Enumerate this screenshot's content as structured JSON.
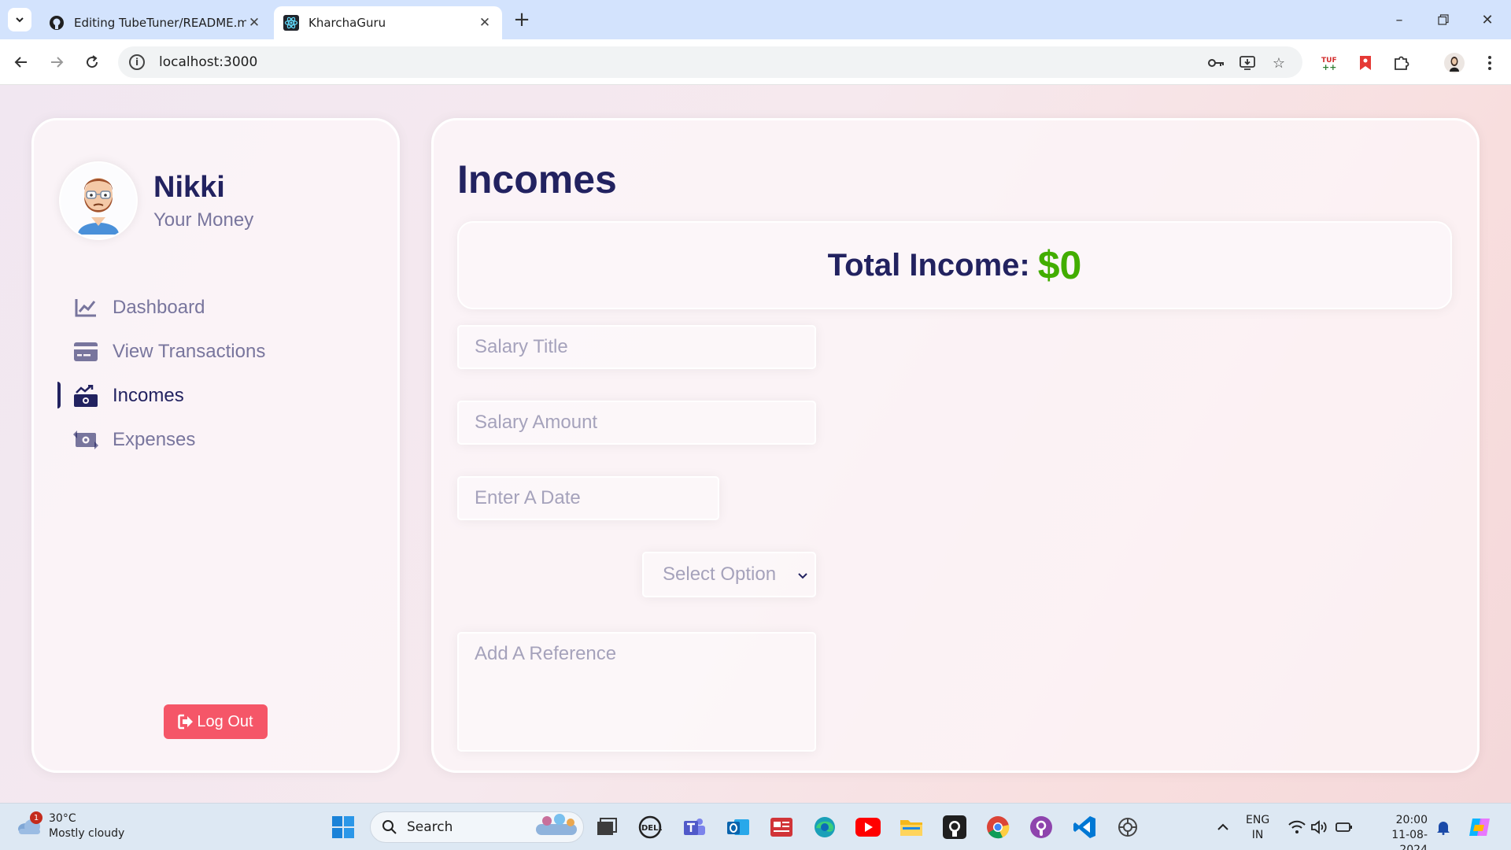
{
  "browser": {
    "tabs": [
      {
        "title": "Editing TubeTuner/README.md",
        "favicon": "github-icon",
        "active": false
      },
      {
        "title": "KharchaGuru",
        "favicon": "react-icon",
        "active": true
      }
    ],
    "url": "localhost:3000"
  },
  "app": {
    "user": {
      "name": "Nikki",
      "subtitle": "Your Money"
    },
    "menu": [
      {
        "label": "Dashboard",
        "icon": "chart-line-icon",
        "active": false
      },
      {
        "label": "View Transactions",
        "icon": "credit-card-icon",
        "active": false
      },
      {
        "label": "Incomes",
        "icon": "money-bill-trend-up-icon",
        "active": true
      },
      {
        "label": "Expenses",
        "icon": "money-bill-transfer-icon",
        "active": false
      }
    ],
    "logout_label": "Log Out",
    "page_title": "Incomes",
    "total_label": "Total Income:",
    "total_value": "$0",
    "form": {
      "title_placeholder": "Salary Title",
      "amount_placeholder": "Salary Amount",
      "date_placeholder": "Enter A Date",
      "select_value": "Select Option",
      "reference_placeholder": "Add A Reference"
    },
    "colors": {
      "primary": "#222260",
      "accent_green": "#42ad00",
      "logout_red": "#f55668"
    }
  },
  "taskbar": {
    "weather_temp": "30°C",
    "weather_desc": "Mostly cloudy",
    "weather_badge": "1",
    "search_label": "Search",
    "lang_line1": "ENG",
    "lang_line2": "IN",
    "time": "20:00",
    "date": "11-08-2024"
  }
}
